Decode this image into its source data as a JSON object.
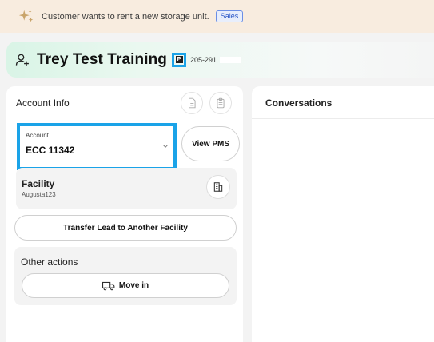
{
  "banner": {
    "icon": "sparkle-icon",
    "text": "Customer wants to rent a new storage unit.",
    "badge": "Sales"
  },
  "header": {
    "icon": "person-add-icon",
    "name": "Trey Test Training",
    "flag_icon": "flag-icon",
    "flag_letter": "P",
    "phone": "205-291"
  },
  "account_info": {
    "title": "Account Info",
    "actions": [
      "document-icon",
      "clipboard-icon"
    ],
    "account": {
      "label": "Account",
      "value": "ECC 11342"
    },
    "view_pms_label": "View PMS",
    "facility": {
      "title": "Facility",
      "value": "Augusta123",
      "icon": "building-icon"
    },
    "transfer_label": "Transfer Lead to Another Facility",
    "other_actions": {
      "title": "Other actions",
      "move_in_label": "Move in",
      "move_in_icon": "truck-icon"
    }
  },
  "conversations": {
    "title": "Conversations"
  },
  "colors": {
    "highlight": "#1aa3e8",
    "banner_bg": "#f8ecdf",
    "header_gradient_start": "#d9f4e6"
  }
}
